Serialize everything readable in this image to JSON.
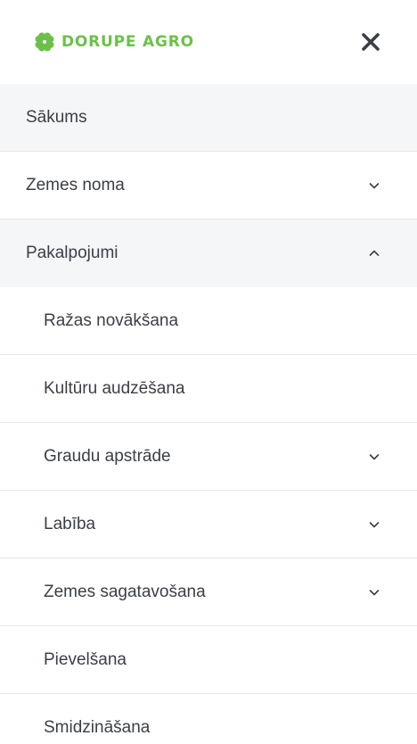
{
  "header": {
    "logo_text": "DORUPE AGRO",
    "brand_color": "#6cc04a",
    "close_icon": "close-icon"
  },
  "menu": {
    "items": [
      {
        "label": "Sākums",
        "active": true,
        "chevron": null
      },
      {
        "label": "Zemes noma",
        "chevron": "down"
      },
      {
        "label": "Pakalpojumi",
        "chevron": "up",
        "expanded": true
      }
    ],
    "sub_items": [
      {
        "label": "Ražas novākšana",
        "chevron": null
      },
      {
        "label": "Kultūru audzēšana",
        "chevron": null
      },
      {
        "label": "Graudu apstrāde",
        "chevron": "down"
      },
      {
        "label": "Labība",
        "chevron": "down"
      },
      {
        "label": "Zemes sagatavošana",
        "chevron": "down"
      },
      {
        "label": "Pievelšana",
        "chevron": null
      },
      {
        "label": "Smidzināšana",
        "chevron": null
      }
    ]
  }
}
